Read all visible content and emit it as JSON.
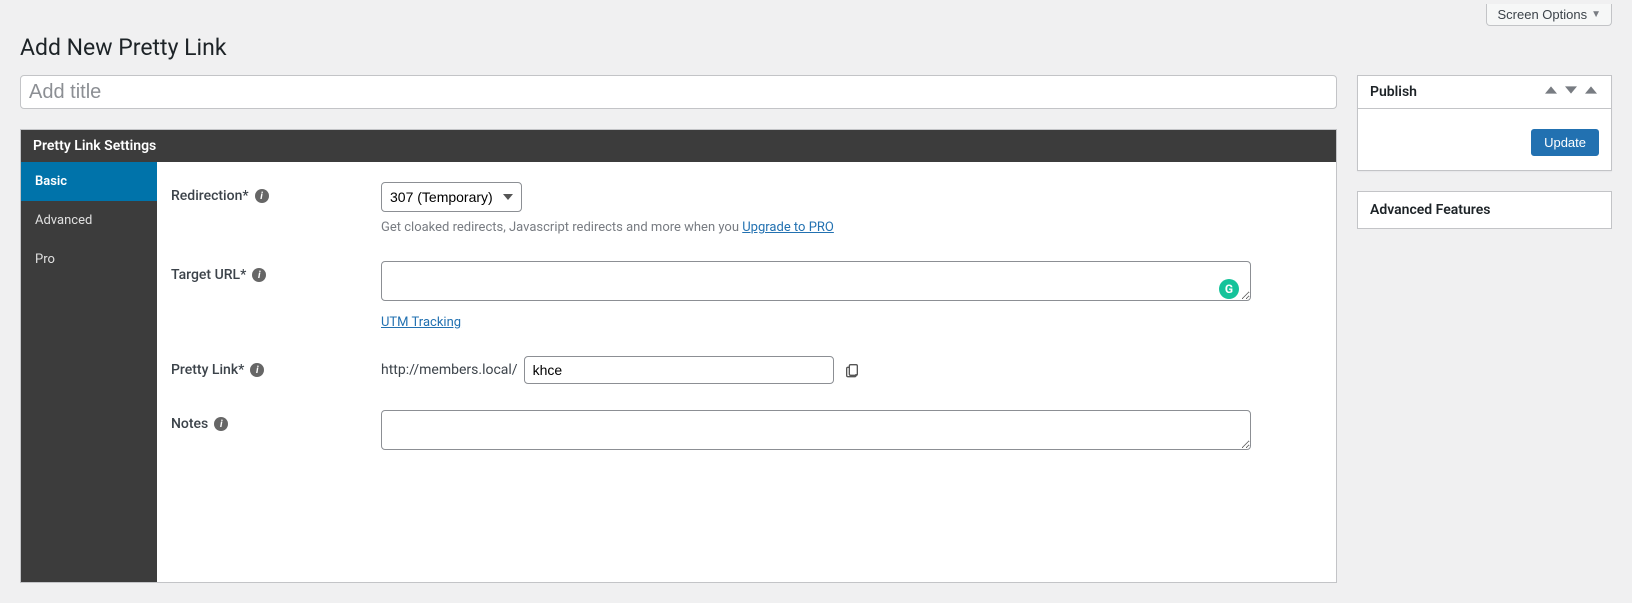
{
  "screen_options_label": "Screen Options",
  "page_title": "Add New Pretty Link",
  "title_placeholder": "Add title",
  "title_value": "",
  "publish": {
    "heading": "Publish",
    "update_label": "Update"
  },
  "advanced_features_heading": "Advanced Features",
  "pl": {
    "panel_title": "Pretty Link Settings",
    "tabs": {
      "basic": "Basic",
      "advanced": "Advanced",
      "pro": "Pro"
    },
    "redirection": {
      "label": "Redirection*",
      "selected": "307 (Temporary)",
      "helper_pre": "Get cloaked redirects, Javascript redirects and more when you ",
      "helper_link": "Upgrade to PRO"
    },
    "target_url": {
      "label": "Target URL*",
      "value": "",
      "utm_link": "UTM Tracking"
    },
    "pretty_link": {
      "label": "Pretty Link*",
      "base": "http://members.local/",
      "slug": "khce"
    },
    "notes": {
      "label": "Notes",
      "value": ""
    }
  }
}
